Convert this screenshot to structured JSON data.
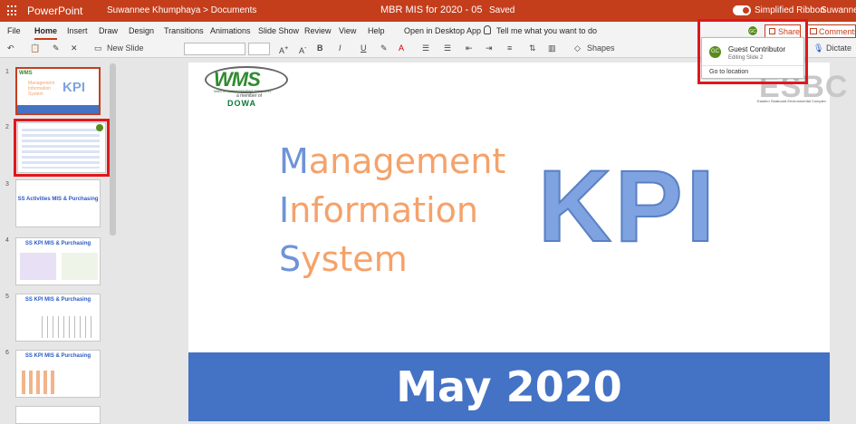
{
  "titlebar": {
    "app_name": "PowerPoint",
    "breadcrumb": "Suwannee Khumphaya > Documents",
    "doc_name": "MBR MIS for 2020 - 05",
    "saved": "Saved",
    "simplified_ribbon": "Simplified Ribbon",
    "user": "Suwannee"
  },
  "tabs": [
    "File",
    "Home",
    "Insert",
    "Draw",
    "Design",
    "Transitions",
    "Animations",
    "Slide Show",
    "Review",
    "View",
    "Help",
    "Open in Desktop App"
  ],
  "tell_me": "Tell me what you want to do",
  "share_label": "Share",
  "comments_label": "Comments",
  "ribbon": {
    "new_slide": "New Slide",
    "shapes": "Shapes",
    "dictate": "Dictate"
  },
  "collab_popup": {
    "initials": "GC",
    "name": "Guest Contributor",
    "status": "Editing Slide 2",
    "goto": "Go to location"
  },
  "thumbnails": [
    {
      "num": "1",
      "title": "KPI"
    },
    {
      "num": "2",
      "title": ""
    },
    {
      "num": "3",
      "title": "SS Activities MIS & Purchasing"
    },
    {
      "num": "4",
      "title": "SS KPI MIS & Purchasing"
    },
    {
      "num": "5",
      "title": "SS KPI MIS & Purchasing"
    },
    {
      "num": "6",
      "title": "SS KPI MIS & Purchasing"
    }
  ],
  "slide": {
    "logo_text": "WMS",
    "logo_sub": "WASTE MANAGEMENT SIAM LTD.",
    "member_of": "a member of",
    "dowa": "DOWA",
    "esbc": "ESBC",
    "esbc_sub": "Eastern Seaboard Environmental Complex",
    "line1_initial": "M",
    "line1_rest": "anagement",
    "line2_initial": "I",
    "line2_rest": "nformation",
    "line3_initial": "S",
    "line3_rest": "ystem",
    "kpi": "KPI",
    "banner": "May 2020"
  }
}
